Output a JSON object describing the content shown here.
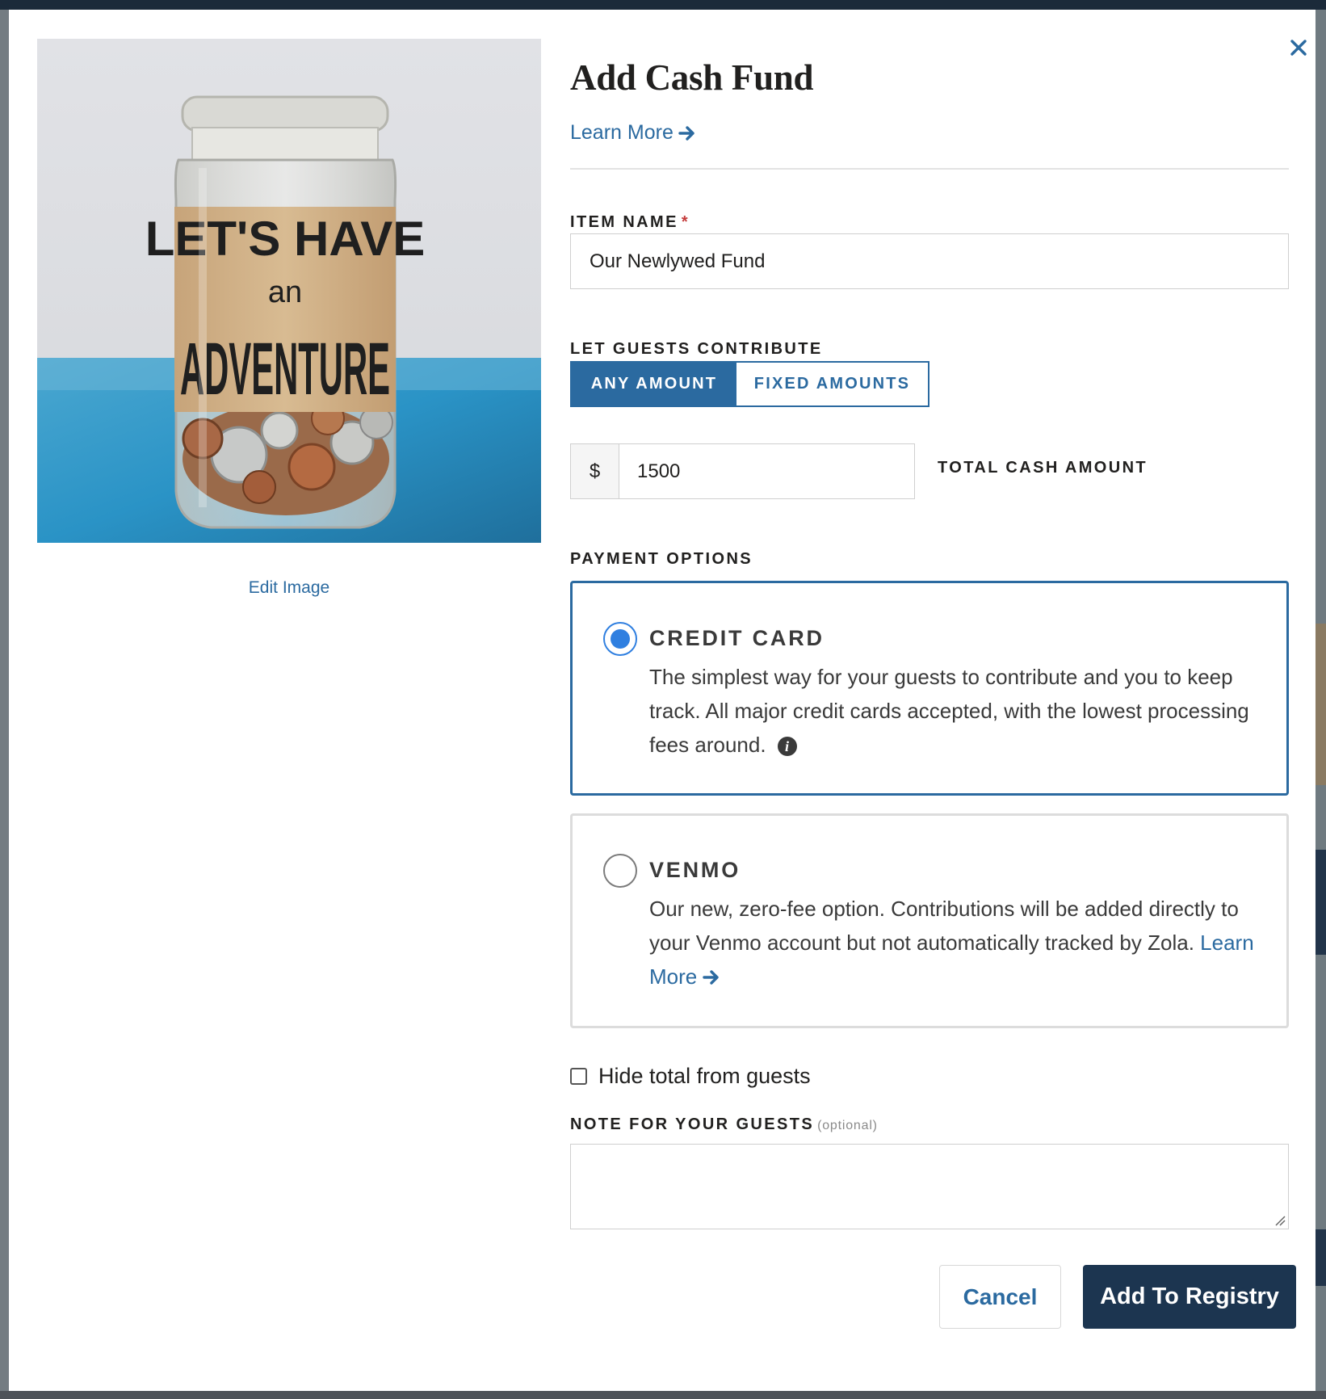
{
  "modal": {
    "title": "Add Cash Fund",
    "learn_more": "Learn More",
    "edit_image": "Edit Image",
    "photo_text": {
      "line1": "LET'S HAVE",
      "line2": "an",
      "line3": "ADVENTURE"
    }
  },
  "item_name": {
    "label": "Item Name",
    "required_marker": "*",
    "value": "Our Newlywed Fund"
  },
  "contribute": {
    "label": "Let Guests Contribute",
    "options": [
      "ANY AMOUNT",
      "FIXED AMOUNTS"
    ],
    "selected": "ANY AMOUNT"
  },
  "amount": {
    "currency_symbol": "$",
    "value": "1500",
    "label": "Total Cash Amount"
  },
  "payment": {
    "label": "Payment Options",
    "credit_card": {
      "title": "CREDIT CARD",
      "description": "The simplest way for your guests to contribute and you to keep track. All major credit cards accepted, with the lowest processing fees around.",
      "selected": true
    },
    "venmo": {
      "title": "VENMO",
      "description": "Our new, zero-fee option. Contributions will be added directly to your Venmo account but not automatically tracked by Zola.",
      "learn_more": "Learn More",
      "selected": false
    }
  },
  "hide_total": {
    "label": "Hide total from guests",
    "checked": false
  },
  "note": {
    "label": "Note for your guests",
    "optional": "(optional)",
    "value": ""
  },
  "buttons": {
    "cancel": "Cancel",
    "add": "Add To Registry"
  },
  "colors": {
    "accent": "#2b6aa0",
    "primary_button": "#1c3550",
    "radio": "#2f7fe0",
    "required": "#c43b3b"
  }
}
